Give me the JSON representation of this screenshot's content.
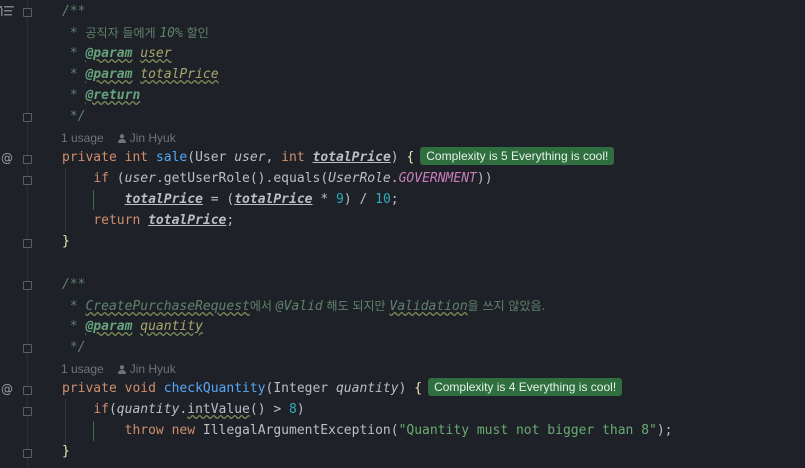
{
  "methods": [
    {
      "doc": {
        "open": "/**",
        "summary_star": "*",
        "summary": "공직자 들에게 ",
        "summary_italic": "10%",
        "summary_end": " 할인",
        "param_tag": "@param",
        "param1": "user",
        "param2": "totalPrice",
        "return_tag": "@return",
        "close": "*/"
      },
      "usage": "1 usage",
      "author": "Jin Hyuk",
      "signature": {
        "modifier": "private",
        "return_type": "int",
        "name": "sale",
        "param1_type": "User",
        "param1_name": "user",
        "param2_type": "int",
        "param2_name": "totalPrice"
      },
      "badge": "Complexity is 5 Everything is cool!",
      "body": {
        "if_kw": "if",
        "if_obj": "user",
        "if_call1": "getUserRole",
        "if_call2": "equals",
        "if_cls": "UserRole",
        "if_const": "GOVERNMENT",
        "assign_lhs": "totalPrice",
        "assign_rhs_var": "totalPrice",
        "num_mul": "9",
        "num_div": "10",
        "return_kw": "return",
        "return_var": "totalPrice"
      }
    },
    {
      "doc": {
        "open": "/**",
        "line1_cls": "CreatePurchaseRequest",
        "line1_kr1": "에서 ",
        "line1_anno": "@Valid",
        "line1_kr2": " 해도 되지만 ",
        "line1_cls2": "Validation",
        "line1_kr3": "을 쓰지 않았음.",
        "param_tag": "@param",
        "param1": "quantity",
        "close": "*/"
      },
      "usage": "1 usage",
      "author": "Jin Hyuk",
      "signature": {
        "modifier": "private",
        "return_type": "void",
        "name": "checkQuantity",
        "param1_type": "Integer",
        "param1_name": "quantity"
      },
      "badge": "Complexity is 4 Everything is cool!",
      "body": {
        "if_kw": "if",
        "if_obj": "quantity",
        "if_call": "intValue",
        "if_num": "8",
        "throw_kw": "throw",
        "new_kw": "new",
        "exc_cls": "IllegalArgumentException",
        "exc_msg": "\"Quantity must not bigger than 8\""
      }
    }
  ],
  "gutter": {
    "override_marker": "@"
  }
}
